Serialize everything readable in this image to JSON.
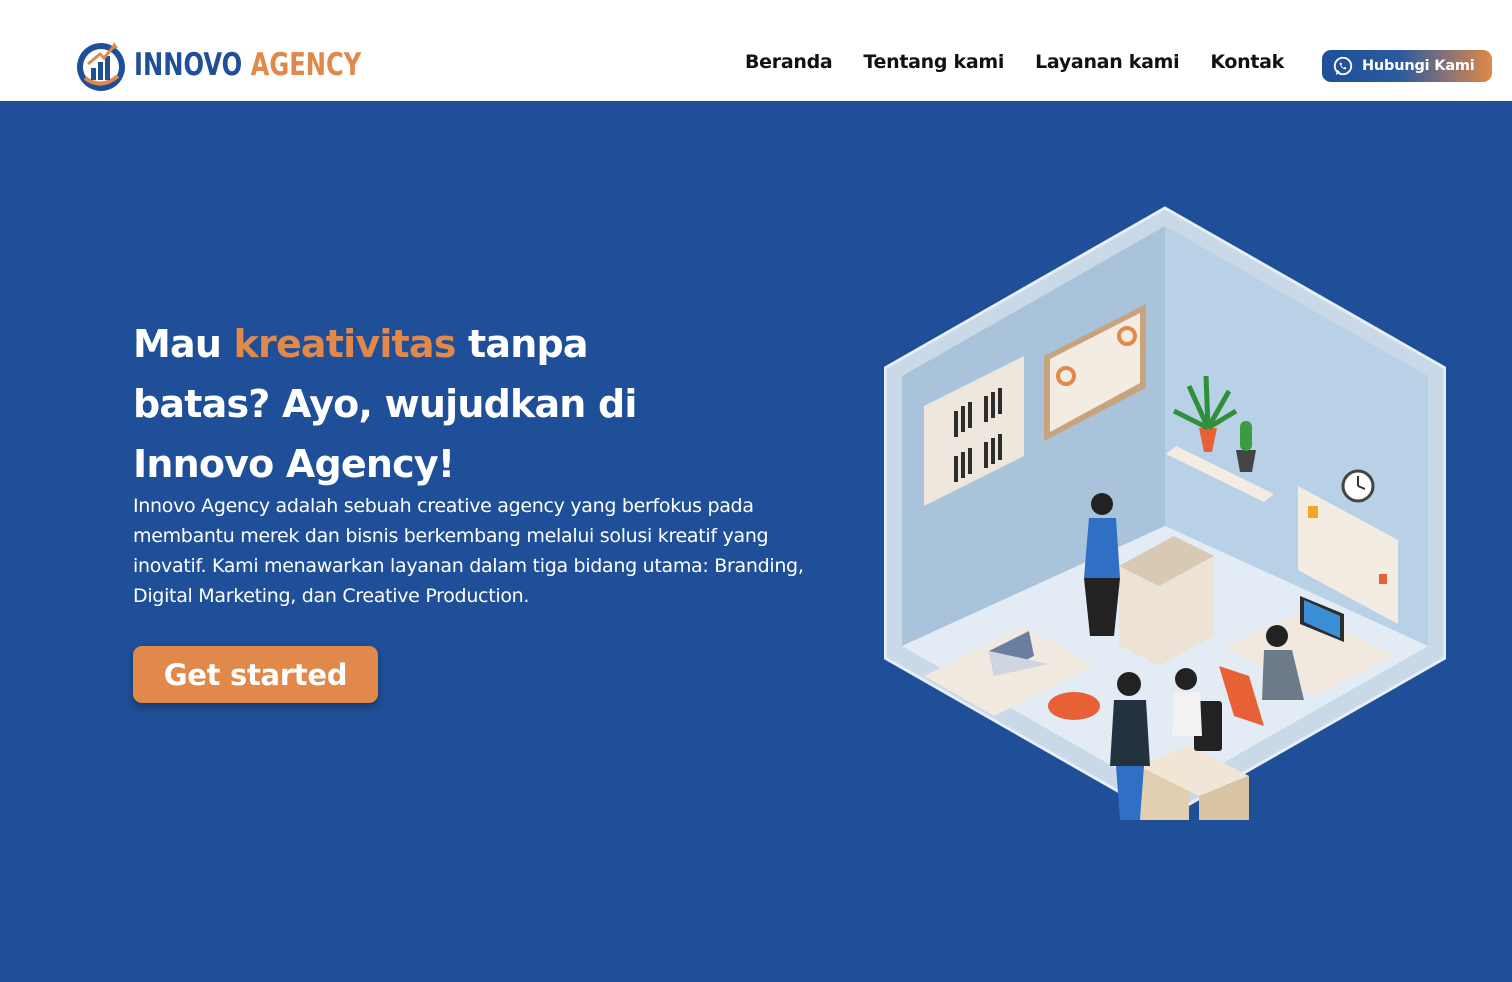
{
  "brand": {
    "name_part1": "INNOVO",
    "name_part2": "AGENCY"
  },
  "nav": {
    "items": [
      {
        "label": "Beranda"
      },
      {
        "label": "Tentang kami"
      },
      {
        "label": "Layanan kami"
      },
      {
        "label": "Kontak"
      }
    ],
    "cta_label": "Hubungi Kami",
    "cta_icon": "whatsapp-icon"
  },
  "hero": {
    "headline_pre": "Mau ",
    "headline_highlight": "kreativitas",
    "headline_post": " tanpa batas? Ayo, wujudkan di Innovo Agency!",
    "description": "Innovo Agency adalah sebuah creative agency yang berfokus pada membantu merek dan bisnis berkembang melalui solusi kreatif yang inovatif. Kami menawarkan layanan dalam tiga bidang utama: Branding, Digital Marketing, dan Creative Production.",
    "button_label": "Get started"
  },
  "colors": {
    "primary": "#1f4f98",
    "accent": "#e0894a",
    "header_bg": "#ffffff",
    "text_dark": "#111111"
  }
}
